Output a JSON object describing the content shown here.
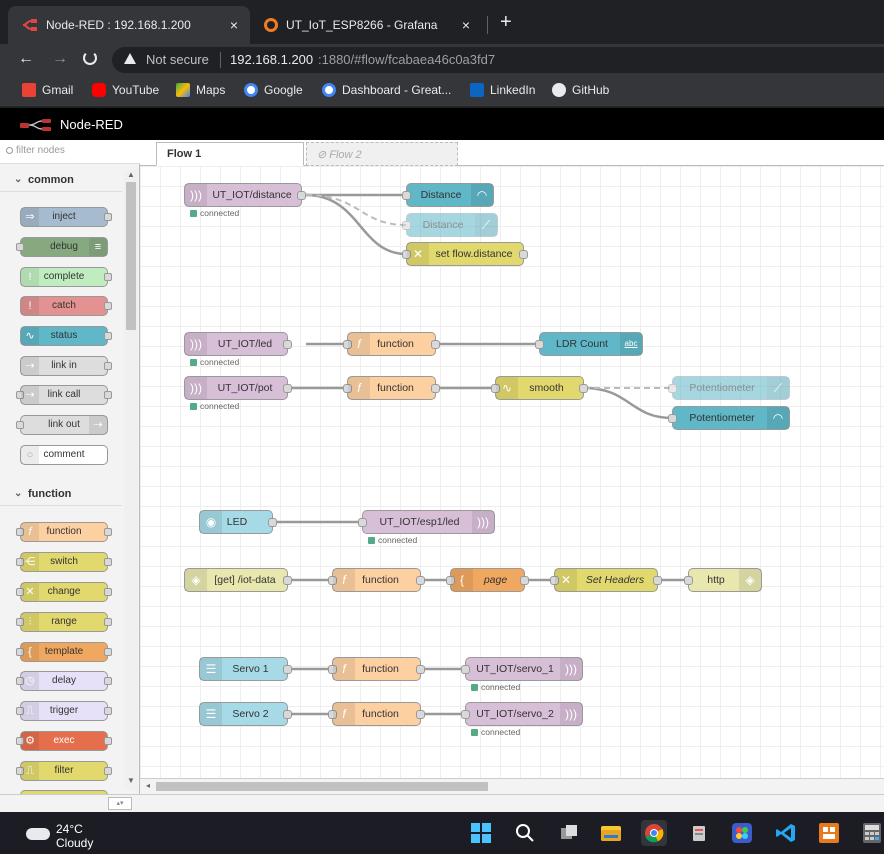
{
  "browser": {
    "tabs": [
      {
        "title": "Node-RED : 192.168.1.200",
        "active": true
      },
      {
        "title": "UT_IoT_ESP8266 - Grafana",
        "active": false
      }
    ],
    "new_tab_icon": "+",
    "close_icon": "×",
    "nav": {
      "back": "←",
      "forward": "→",
      "reload": "C"
    },
    "security_label": "Not secure",
    "url_host": "192.168.1.200",
    "url_rest": ":1880/#flow/fcabaea46c0a3fd7",
    "bookmarks": [
      "Gmail",
      "YouTube",
      "Maps",
      "Google",
      "Dashboard - Great...",
      "LinkedIn",
      "GitHub"
    ]
  },
  "app": {
    "title": "Node-RED"
  },
  "palette": {
    "filter_placeholder": "filter nodes",
    "categories": [
      {
        "label": "common",
        "nodes": [
          "inject",
          "debug",
          "complete",
          "catch",
          "status",
          "link in",
          "link call",
          "link out",
          "comment"
        ]
      },
      {
        "label": "function",
        "nodes": [
          "function",
          "switch",
          "change",
          "range",
          "template",
          "delay",
          "trigger",
          "exec",
          "filter"
        ]
      }
    ],
    "scroll_up": "▲",
    "scroll_down": "▼"
  },
  "workspace": {
    "tabs": [
      {
        "label": "Flow 1",
        "active": true
      },
      {
        "label": "Flow 2",
        "disabled": true
      }
    ]
  },
  "flow_nodes": {
    "dist_in": "UT_IOT/distance",
    "dist_gauge": "Distance",
    "dist_chart": "Distance",
    "set_flow": "set flow.distance",
    "led_in": "UT_IOT/led",
    "fn_led": "function",
    "ldr_text": "LDR Count",
    "pot_in": "UT_IOT/pot",
    "fn_pot": "function",
    "smooth": "smooth",
    "pot_chart": "Potentiometer",
    "pot_gauge": "Potentiometer",
    "led_switch": "LED",
    "led_out": "UT_IOT/esp1/led",
    "http_in": "[get] /iot-data",
    "fn_http": "function",
    "page": "page",
    "set_headers": "Set Headers",
    "http_out": "http",
    "servo1": "Servo 1",
    "fn_servo1": "function",
    "servo1_out": "UT_IOT/servo_1",
    "servo2": "Servo 2",
    "fn_servo2": "function",
    "servo2_out": "UT_IOT/servo_2",
    "status_connected": "connected",
    "abc_badge": "abc"
  },
  "taskbar": {
    "temperature": "24°C",
    "condition": "Cloudy"
  },
  "colors": {
    "mqtt": "#d8bfd8",
    "dashboard": "#5fb7c7",
    "function": "#fdd0a2",
    "change": "#e2d96e",
    "http": "#e7e7ae",
    "template": "#f0a860",
    "inject": "#a6bbcf",
    "debug": "#87a980",
    "complete": "#c0edc0",
    "catch": "#e49191",
    "link": "#dddddd",
    "exec": "#e56e4c",
    "ui_input": "#a5dae6"
  }
}
